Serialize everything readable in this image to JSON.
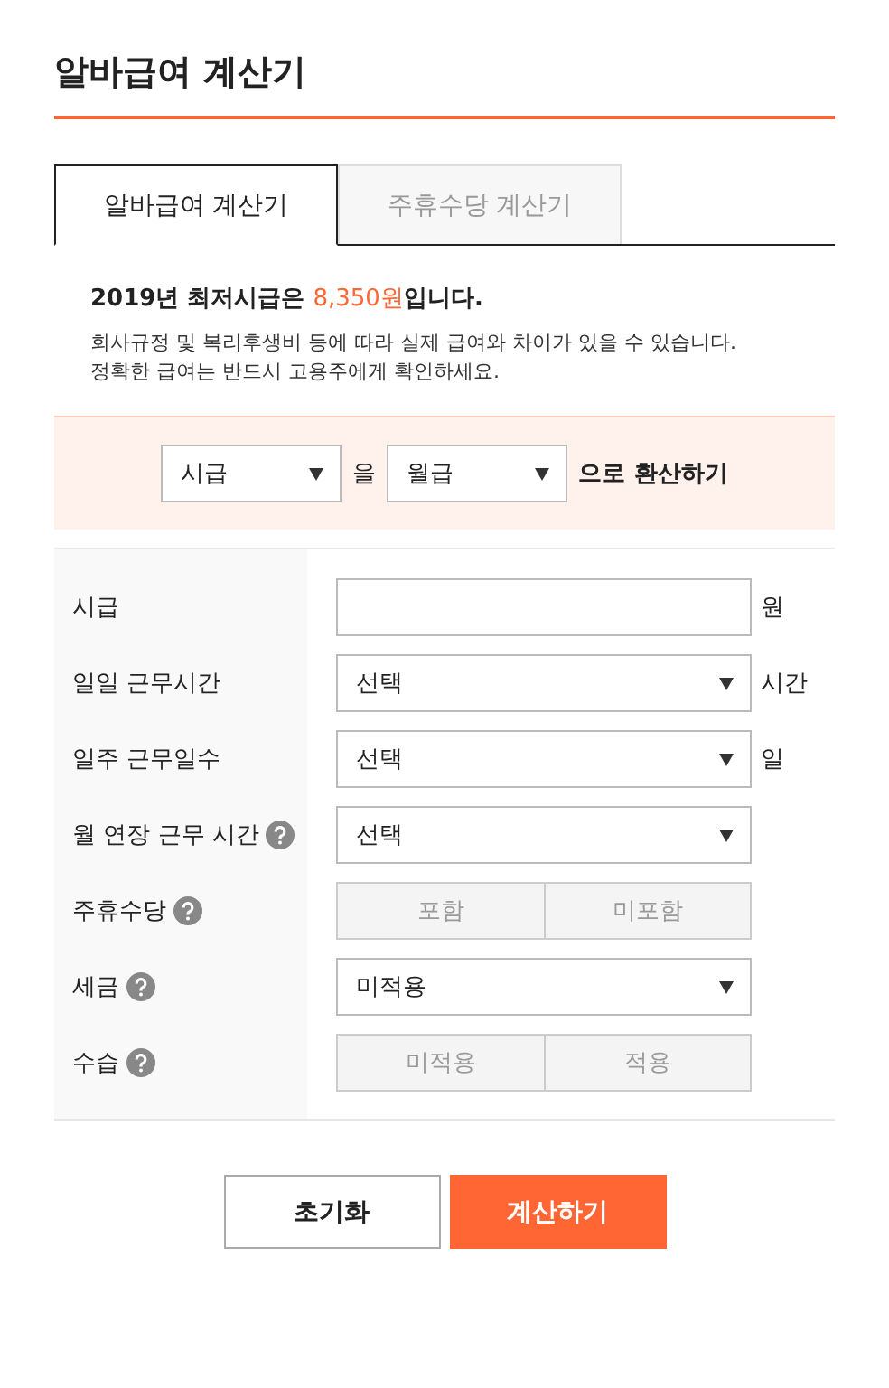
{
  "title": "알바급여 계산기",
  "tabs": [
    {
      "label": "알바급여 계산기",
      "selected": true
    },
    {
      "label": "주휴수당 계산기",
      "selected": false
    }
  ],
  "notice": {
    "headline_before": "2019년 최저시급은 ",
    "wage": "8,350원",
    "headline_after": "입니다.",
    "lines": [
      "회사규정 및 복리후생비 등에 따라 실제 급여와 차이가 있을 수 있습니다.",
      "정확한 급여는 반드시 고용주에게 확인하세요."
    ]
  },
  "conversion": {
    "from": "시급",
    "joiner": "을",
    "to": "월급",
    "suffix": "으로 환산하기"
  },
  "fields": [
    {
      "label": "시급",
      "kind": "input",
      "help": false,
      "unit": "원"
    },
    {
      "label": "일일 근무시간",
      "kind": "select",
      "help": false,
      "value": "선택",
      "unit": "시간"
    },
    {
      "label": "일주 근무일수",
      "kind": "select",
      "help": false,
      "value": "선택",
      "unit": "일"
    },
    {
      "label": "월 연장 근무 시간",
      "kind": "select",
      "help": true,
      "value": "선택"
    },
    {
      "label": "주휴수당",
      "kind": "toggle",
      "help": true,
      "options": [
        {
          "label": "포함",
          "selected": false
        },
        {
          "label": "미포함",
          "selected": false
        }
      ]
    },
    {
      "label": "세금",
      "kind": "select",
      "help": true,
      "value": "미적용"
    },
    {
      "label": "수습",
      "kind": "toggle",
      "help": true,
      "options": [
        {
          "label": "미적용",
          "selected": false
        },
        {
          "label": "적용",
          "selected": false
        }
      ]
    }
  ],
  "buttons": [
    {
      "label": "초기화",
      "kind": "secondary"
    },
    {
      "label": "계산하기",
      "kind": "primary"
    }
  ]
}
